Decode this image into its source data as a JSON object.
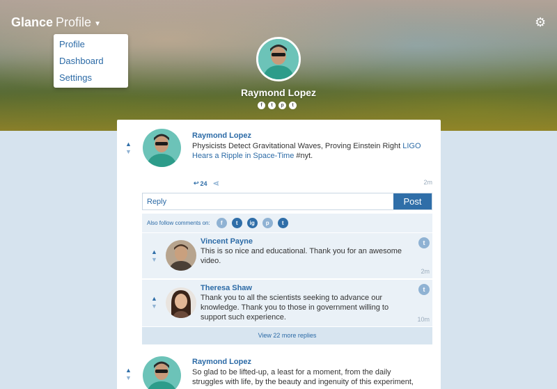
{
  "header": {
    "brand_bold": "Glance",
    "brand_light": "Profile",
    "caret_icon": "caret-down-icon",
    "settings_icon": "gear-icon"
  },
  "menu": {
    "items": [
      {
        "label": "Profile"
      },
      {
        "label": "Dashboard"
      },
      {
        "label": "Settings"
      }
    ]
  },
  "profile": {
    "name": "Raymond Lopez",
    "social": [
      "f",
      "t",
      "p",
      "t"
    ]
  },
  "post": {
    "author": "Raymond Lopez",
    "text_before": "Physicists Detect Gravitational Waves, Proving Einstein Right ",
    "link": "LIGO Hears a Ripple in Space-Time",
    "text_after": " #nyt.",
    "time": "2m",
    "reply_count": "24"
  },
  "reply_box": {
    "placeholder": "Reply",
    "button": "Post"
  },
  "follow": {
    "label": "Also follow comments on:",
    "networks": [
      "f",
      "t",
      "ig",
      "p",
      "t"
    ],
    "colors": [
      "#8fb2d3",
      "#2f6ea8",
      "#2f6ea8",
      "#8fb2d3",
      "#2f6ea8"
    ]
  },
  "comments": [
    {
      "author": "Vincent Payne",
      "text": "This is so nice and educational. Thank you for an awesome video.",
      "time": "2m"
    },
    {
      "author": "Theresa Shaw",
      "text": "Thank you to all the scientists seeking to advance our knowledge. Thank you to those in government willing to support such experience.",
      "time": "10m"
    }
  ],
  "more_replies": "View 22 more replies",
  "post2": {
    "author": "Raymond Lopez",
    "text": "So glad to be lifted-up, a least for a moment, from the daily struggles with life, by the beauty and ingenuity of this experiment,"
  },
  "colors": {
    "accent": "#2f6ea8",
    "background": "#d6e3ee"
  }
}
